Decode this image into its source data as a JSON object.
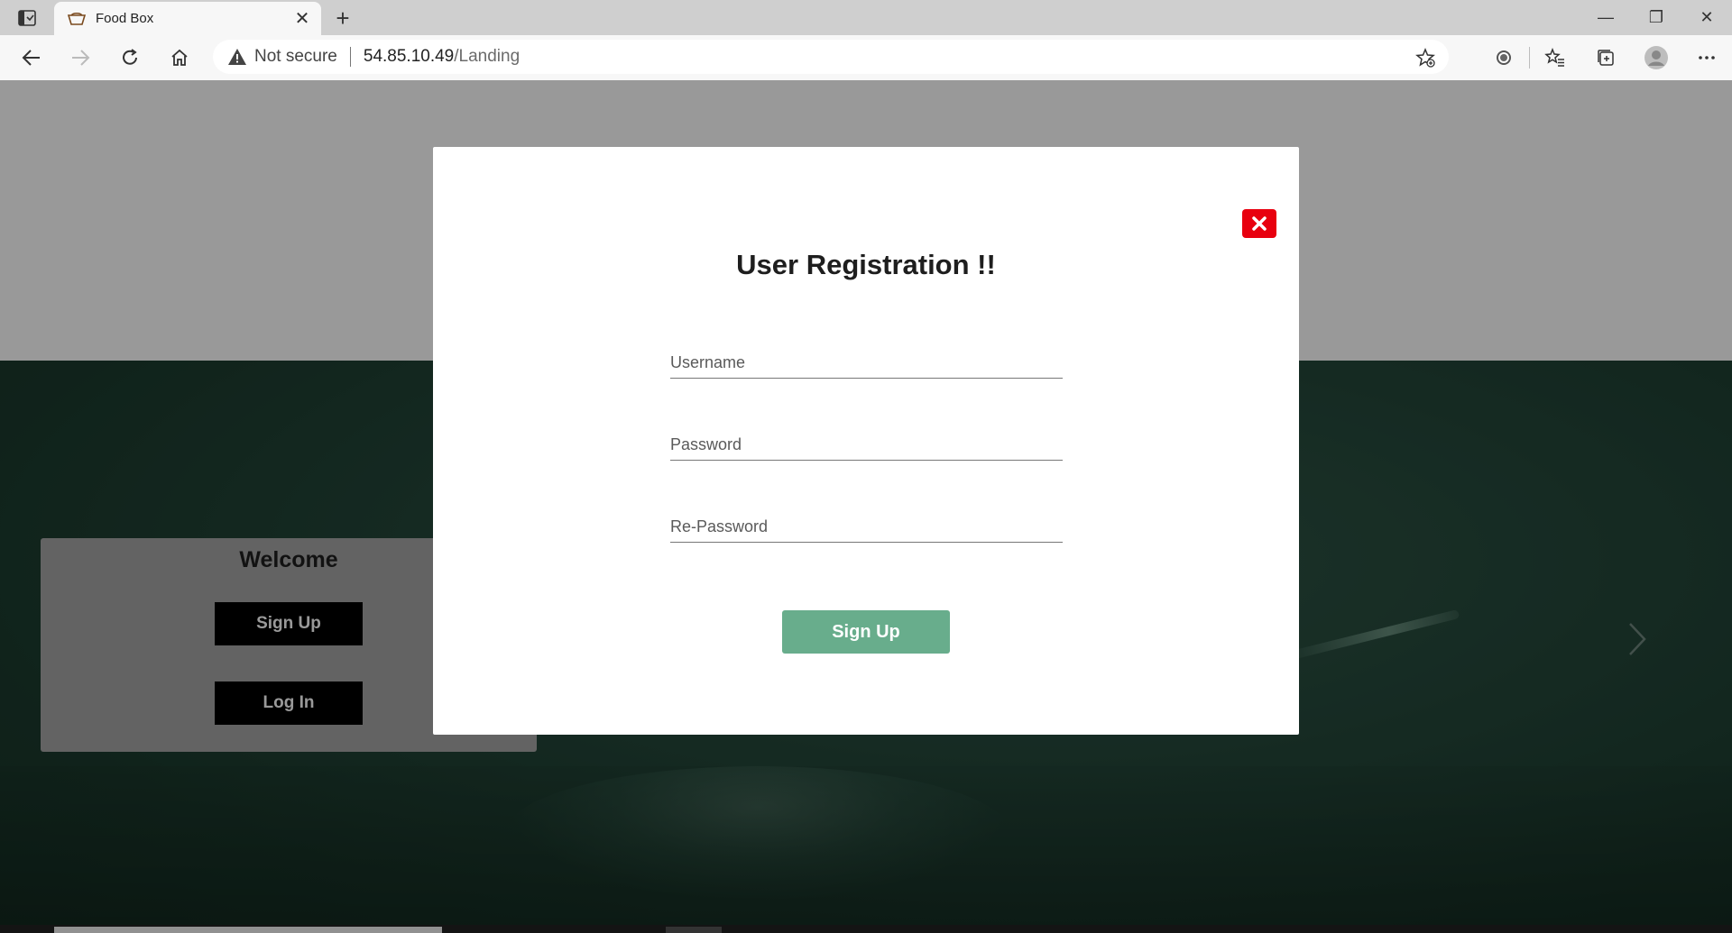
{
  "browser": {
    "tab_title": "Food Box",
    "tab_close": "✕",
    "new_tab": "+",
    "security_label": "Not secure",
    "url_host": "54.85.10.49",
    "url_path": "/Landing",
    "window_controls": {
      "minimize": "—",
      "restore": "❐",
      "close": "✕"
    }
  },
  "welcome": {
    "title": "Welcome",
    "signup_label": "Sign Up",
    "login_label": "Log In"
  },
  "modal": {
    "title": "User Registration !!",
    "username_placeholder": "Username",
    "password_placeholder": "Password",
    "repassword_placeholder": "Re-Password",
    "submit_label": "Sign Up"
  },
  "colors": {
    "close_button": "#e8000f",
    "submit_button": "#68ad8c",
    "hero_green": "#24473a"
  }
}
